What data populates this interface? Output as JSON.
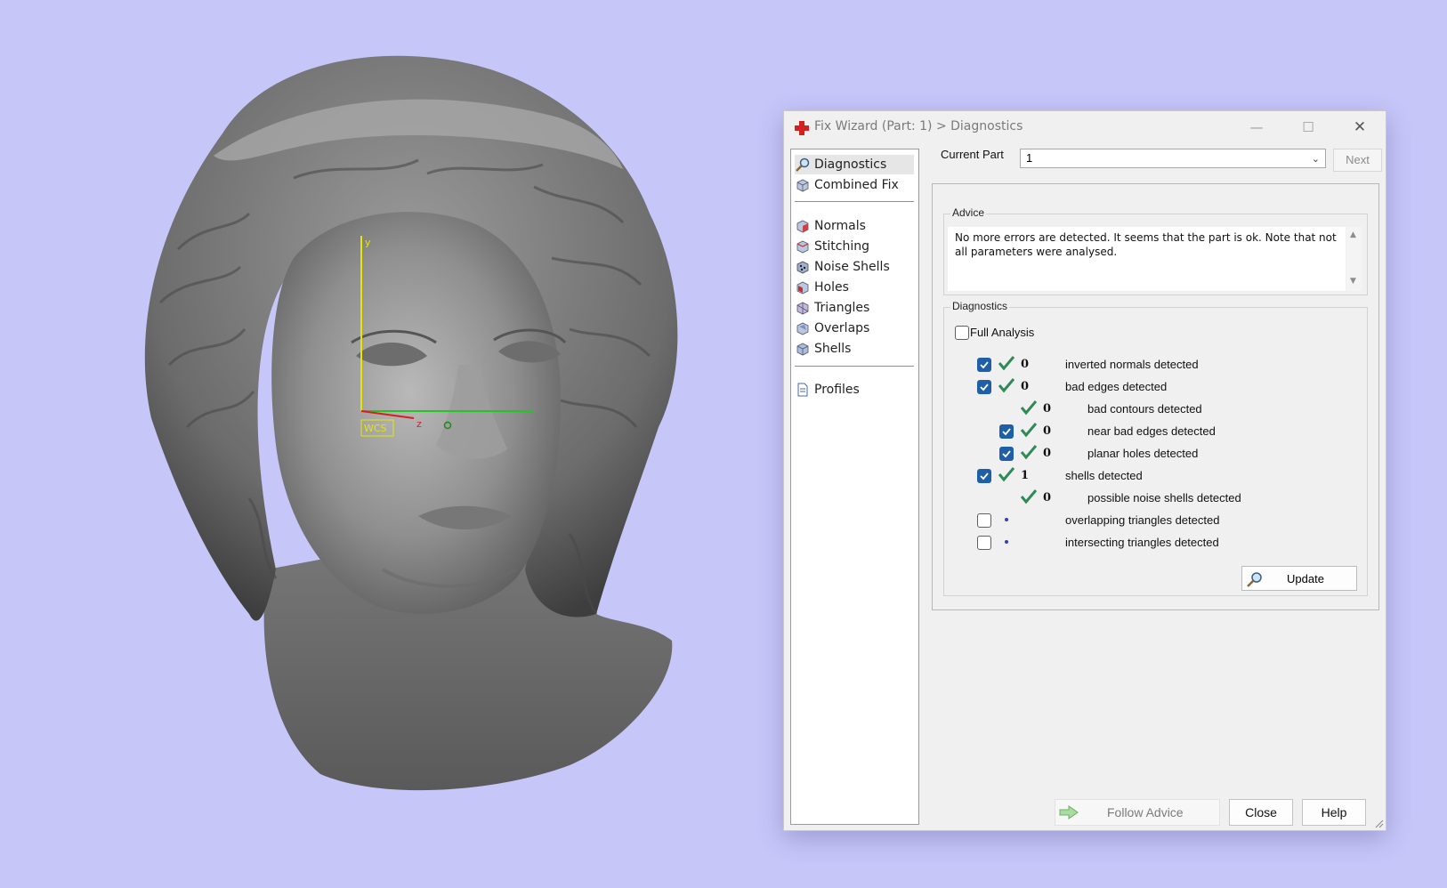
{
  "viewport": {
    "background": "#c6c6f9",
    "axis_labels": {
      "y": "y",
      "z": "z",
      "wcs": "WCS"
    }
  },
  "dialog": {
    "title": "Fix Wizard (Part: 1) > Diagnostics",
    "window_controls": {
      "minimize": "—",
      "maximize": "☐",
      "close": "✕"
    },
    "nav": {
      "items": [
        {
          "label": "Diagnostics",
          "icon": "magnifier-icon",
          "selected": true
        },
        {
          "label": "Combined Fix",
          "icon": "cube-icon"
        },
        {
          "label": "Normals",
          "icon": "normals-cube-icon"
        },
        {
          "label": "Stitching",
          "icon": "stitching-cube-icon"
        },
        {
          "label": "Noise Shells",
          "icon": "noise-shells-icon"
        },
        {
          "label": "Holes",
          "icon": "holes-cube-icon"
        },
        {
          "label": "Triangles",
          "icon": "triangles-cube-icon"
        },
        {
          "label": "Overlaps",
          "icon": "overlaps-cube-icon"
        },
        {
          "label": "Shells",
          "icon": "shells-cube-icon"
        },
        {
          "label": "Profiles",
          "icon": "document-icon"
        }
      ]
    },
    "current_part_label": "Current Part",
    "current_part_value": "1",
    "next_label": "Next",
    "advice": {
      "title": "Advice",
      "text": "No more errors are detected. It seems that the part is ok. Note that not all parameters were analysed."
    },
    "diagnostics": {
      "title": "Diagnostics",
      "full_analysis_label": "Full Analysis",
      "full_analysis_checked": false,
      "rows": [
        {
          "checkbox": true,
          "status": "ok",
          "count": "0",
          "label": "inverted normals detected",
          "indent": 0
        },
        {
          "checkbox": true,
          "status": "ok",
          "count": "0",
          "label": "bad edges detected",
          "indent": 0
        },
        {
          "checkbox": null,
          "status": "ok",
          "count": "0",
          "label": "bad contours detected",
          "indent": 1
        },
        {
          "checkbox": true,
          "status": "ok",
          "count": "0",
          "label": "near bad edges detected",
          "indent": 1
        },
        {
          "checkbox": true,
          "status": "ok",
          "count": "0",
          "label": "planar holes detected",
          "indent": 1
        },
        {
          "checkbox": true,
          "status": "ok",
          "count": "1",
          "label": "shells detected",
          "indent": 0
        },
        {
          "checkbox": null,
          "status": "ok",
          "count": "0",
          "label": "possible noise shells detected",
          "indent": 1
        },
        {
          "checkbox": false,
          "status": "pending",
          "count": "",
          "label": "overlapping triangles detected",
          "indent": 0
        },
        {
          "checkbox": false,
          "status": "pending",
          "count": "",
          "label": "intersecting triangles detected",
          "indent": 0
        }
      ],
      "update_label": "Update"
    },
    "buttons": {
      "follow_advice": "Follow Advice",
      "close": "Close",
      "help": "Help"
    },
    "colors": {
      "accent": "#1e5fa8",
      "ok_check": "#2e8b57",
      "app_icon": "#d32020"
    }
  }
}
